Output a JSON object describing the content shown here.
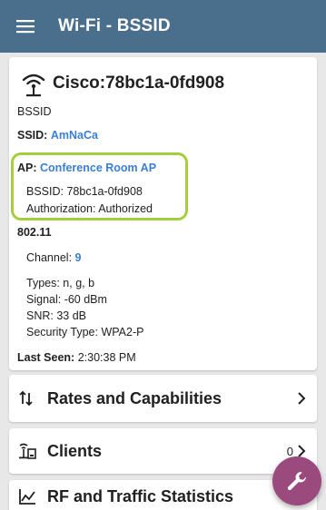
{
  "appbar": {
    "title": "Wi-Fi - BSSID",
    "menu_icon": "menu-icon"
  },
  "bssid": {
    "name": "Cisco:78bc1a-0fd908",
    "type_label": "BSSID",
    "ssid_label": "SSID:",
    "ssid_value": "AmNaCa",
    "ap_label": "AP:",
    "ap_value": "Conference Room AP",
    "ap_bssid": "BSSID:  78bc1a-0fd908",
    "authorization": "Authorization:  Authorized",
    "standard": "802.11",
    "channel_label": "Channel:",
    "channel_value": "9",
    "types": "Types:  n, g, b",
    "signal": "Signal:  -60 dBm",
    "snr": "SNR:  33 dB",
    "security": "Security Type:  WPA2-P",
    "last_seen_label": "Last Seen:",
    "last_seen_value": "2:30:38 PM"
  },
  "sections": {
    "rates": {
      "label": "Rates and Capabilities",
      "icon": "sort-arrows-icon"
    },
    "clients": {
      "label": "Clients",
      "count": "0",
      "icon": "clients-icon"
    },
    "rf": {
      "label": "RF and Traffic Statistics",
      "icon": "chart-icon"
    }
  },
  "fab_icon": "wrench-icon",
  "colors": {
    "appbar": "#4a6f8c",
    "link": "#3a7fd5",
    "highlight": "#a4cf3c",
    "fab": "#9b4a7d"
  }
}
